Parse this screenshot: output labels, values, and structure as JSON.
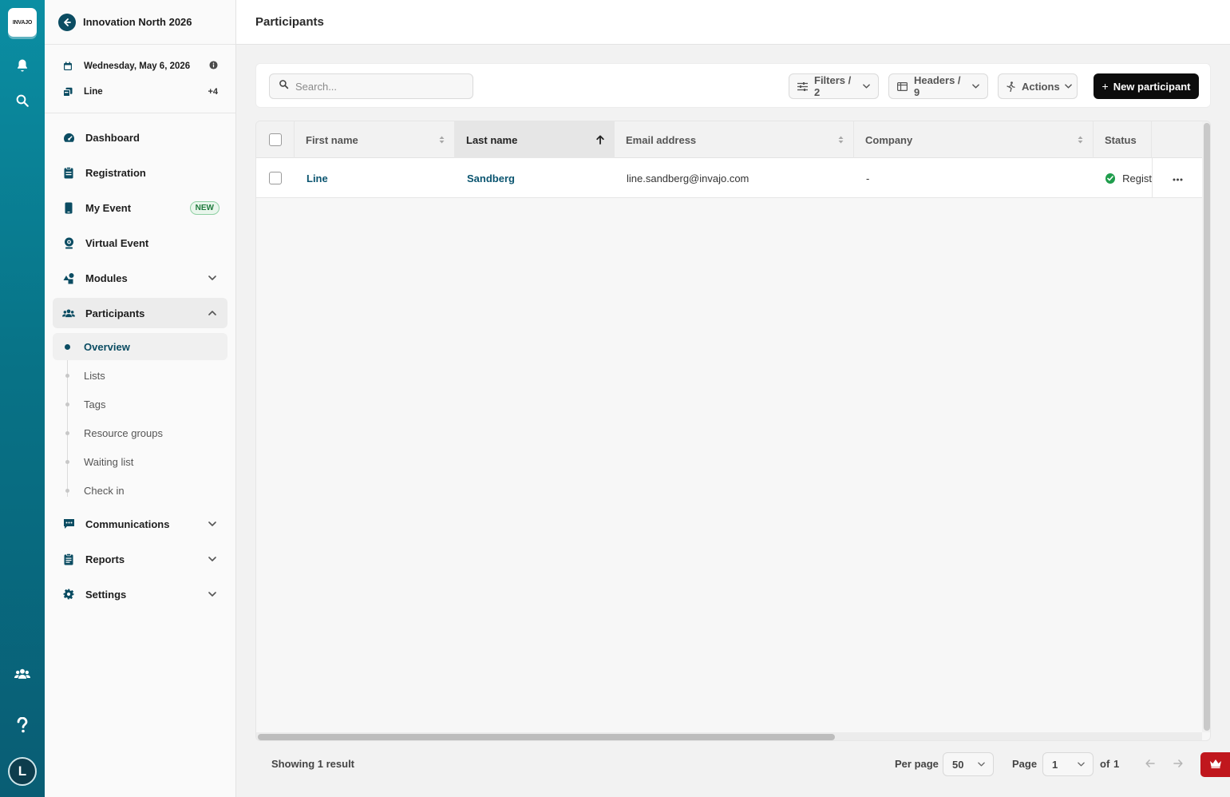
{
  "app": {
    "logo_text": "INVAJO"
  },
  "rail": {
    "icons": [
      "bell-icon",
      "search-icon",
      "people-icon",
      "help-icon"
    ],
    "avatar_initial": "L"
  },
  "sidebar": {
    "event_title": "Innovation North 2026",
    "date": "Wednesday, May 6, 2026",
    "line_label": "Line",
    "line_extra": "+4",
    "nav": {
      "dashboard": "Dashboard",
      "registration": "Registration",
      "my_event": "My Event",
      "my_event_badge": "NEW",
      "virtual_event": "Virtual Event",
      "modules": "Modules",
      "participants": "Participants",
      "communications": "Communications",
      "reports": "Reports",
      "settings": "Settings"
    },
    "participants_sub": [
      "Overview",
      "Lists",
      "Tags",
      "Resource groups",
      "Waiting list",
      "Check in"
    ]
  },
  "header": {
    "title": "Participants"
  },
  "toolbar": {
    "search_placeholder": "Search...",
    "filters_label": "Filters / 2",
    "headers_label": "Headers / 9",
    "actions_label": "Actions",
    "new_participant_label": "New participant"
  },
  "table": {
    "columns": [
      "First name",
      "Last name",
      "Email address",
      "Company",
      "Status"
    ],
    "sorted_column": "Last name",
    "sort_direction": "ascending",
    "rows": [
      {
        "first_name": "Line",
        "last_name": "Sandberg",
        "email": "line.sandberg@invajo.com",
        "company": "-",
        "status": "Regist"
      }
    ]
  },
  "footer": {
    "result_text": "Showing 1 result",
    "per_page_label": "Per page",
    "per_page_value": "50",
    "page_label": "Page",
    "page_value": "1",
    "of_label": "of",
    "total_pages": "1"
  },
  "colors": {
    "rail_top": "#0b8ea3",
    "rail_bottom": "#095d74",
    "accent": "#0b4c62",
    "primary_button": "#0c0c0c",
    "status_ok": "#1f9d4c",
    "crown_button": "#c0171d"
  }
}
